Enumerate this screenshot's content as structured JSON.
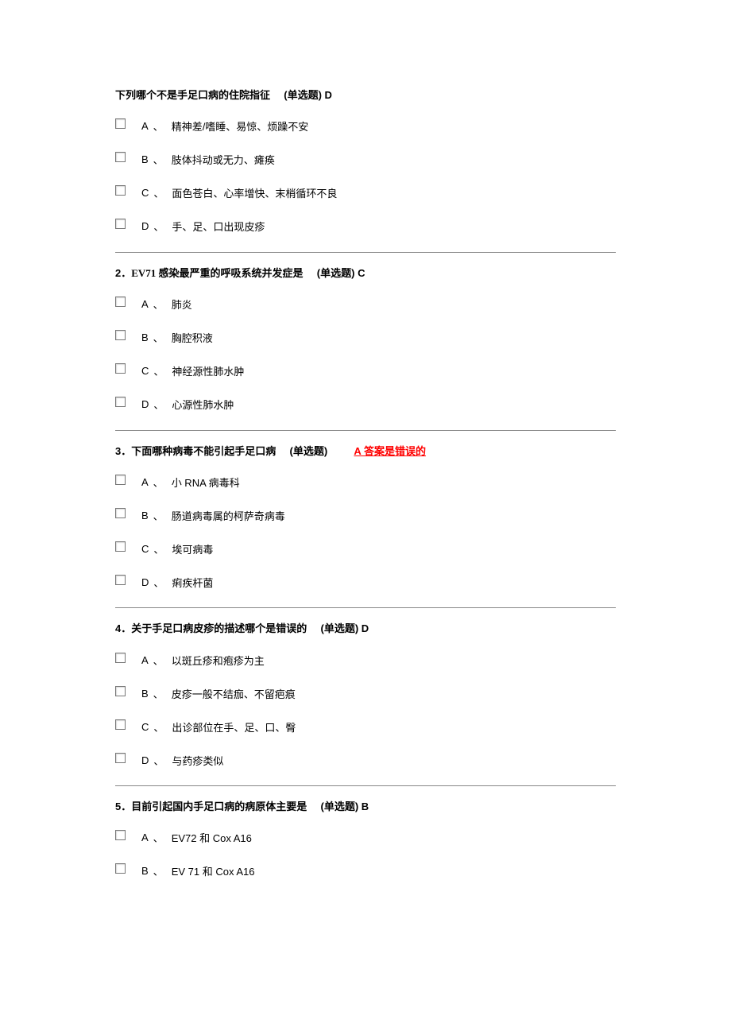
{
  "questions": [
    {
      "num": "",
      "title": "下列哪个不是手足口病的住院指征",
      "type": "(单选题)",
      "answer": " D",
      "note": "",
      "options": [
        {
          "letter": "A",
          "text": "精神差/嗜睡、易惊、烦躁不安"
        },
        {
          "letter": "B",
          "text": "肢体抖动或无力、瘫痪"
        },
        {
          "letter": "C",
          "text": "面色苍白、心率增快、末梢循环不良"
        },
        {
          "letter": "D",
          "text": "手、足、口出现皮疹"
        }
      ]
    },
    {
      "num": "2．",
      "title": "EV71 感染最严重的呼吸系统并发症是",
      "type": "(单选题)",
      "answer": " C",
      "note": "",
      "options": [
        {
          "letter": "A",
          "text": "肺炎"
        },
        {
          "letter": "B",
          "text": "胸腔积液"
        },
        {
          "letter": "C",
          "text": "神经源性肺水肿"
        },
        {
          "letter": "D",
          "text": "心源性肺水肿"
        }
      ]
    },
    {
      "num": "3．",
      "title": "下面哪种病毒不能引起手足口病",
      "type": "(单选题)",
      "answer": "",
      "note": "A 答案是错误的",
      "options": [
        {
          "letter": "A",
          "text": "小 RNA 病毒科"
        },
        {
          "letter": "B",
          "text": "肠道病毒属的柯萨奇病毒"
        },
        {
          "letter": "C",
          "text": "埃可病毒"
        },
        {
          "letter": "D",
          "text": "痢疾杆菌"
        }
      ]
    },
    {
      "num": "4．",
      "title": "关于手足口病皮疹的描述哪个是错误的",
      "type": "(单选题)",
      "answer": " D",
      "note": "",
      "options": [
        {
          "letter": "A",
          "text": "以斑丘疹和疱疹为主"
        },
        {
          "letter": "B",
          "text": "皮疹一般不结痂、不留疤痕"
        },
        {
          "letter": "C",
          "text": "出诊部位在手、足、口、臀"
        },
        {
          "letter": "D",
          "text": "与药疹类似"
        }
      ]
    },
    {
      "num": "5．",
      "title": "目前引起国内手足口病的病原体主要是",
      "type": "(单选题)",
      "answer": " B",
      "note": "",
      "options": [
        {
          "letter": "A",
          "text": "EV72 和 Cox A16"
        },
        {
          "letter": "B",
          "text": "EV 71 和 Cox A16"
        }
      ]
    }
  ],
  "sep": "、"
}
